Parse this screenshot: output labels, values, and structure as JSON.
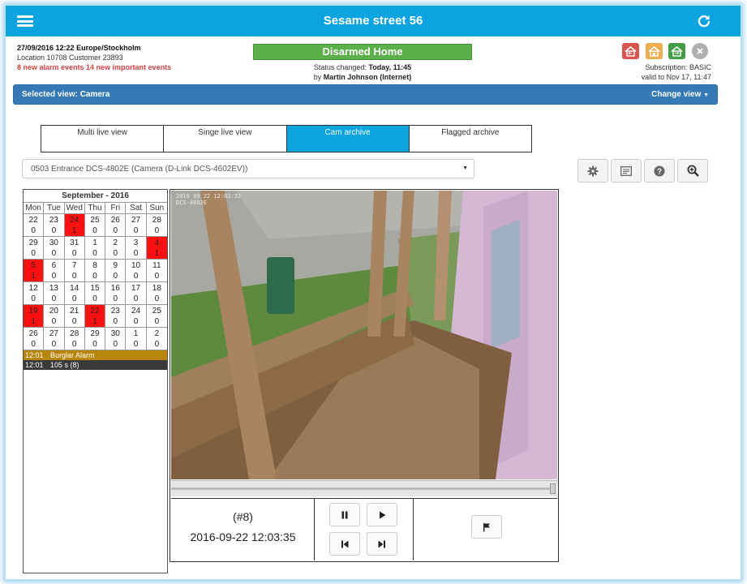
{
  "header": {
    "title": "Sesame street 56",
    "menu_icon": "hamburger-icon",
    "refresh_icon": "refresh-icon",
    "bar_color": "#0aa4e0"
  },
  "info": {
    "datetime": "27/09/2016 12:22 Europe/Stockholm",
    "location": "Location 10708 Customer 23893",
    "alerts": "8 new alarm events 14 new important events"
  },
  "status": {
    "label": "Disarmed Home",
    "changed_prefix": "Status changed: ",
    "changed_when": "Today, 11:45",
    "by_prefix": "by ",
    "by_who": "Martin Johnson (Internet)",
    "color": "#5bb04a"
  },
  "mode_icons": [
    {
      "name": "armed-away-icon",
      "color": "#d9534f"
    },
    {
      "name": "armed-home-icon",
      "color": "#f0ad4e"
    },
    {
      "name": "disarmed-home-icon",
      "color": "#449d44"
    },
    {
      "name": "disarmed-off-icon",
      "color": "#b0b0b0"
    }
  ],
  "subscription": {
    "line1": "Subscription: BASIC",
    "line2": "valid to Nov 17, 11:47"
  },
  "view_bar": {
    "selected": "Selected view: Camera",
    "change": "Change view"
  },
  "tabs": [
    {
      "label": "Multi live view",
      "active": false
    },
    {
      "label": "Singe live view",
      "active": false
    },
    {
      "label": "Cam archive",
      "active": true
    },
    {
      "label": "Flagged archive",
      "active": false
    }
  ],
  "camera_select": {
    "value": "0503 Entrance DCS-4802E (Camera (D-Link DCS-4602EV))"
  },
  "toolbar_icons": [
    "gear-icon",
    "list-icon",
    "help-icon",
    "zoom-in-icon"
  ],
  "calendar": {
    "title": "September - 2016",
    "weekdays": [
      "Mon",
      "Tue",
      "Wed",
      "Thu",
      "Fri",
      "Sat",
      "Sun"
    ],
    "weeks": [
      [
        {
          "d": "22",
          "c": "0"
        },
        {
          "d": "23",
          "c": "0"
        },
        {
          "d": "24",
          "c": "1",
          "alarm": true
        },
        {
          "d": "25",
          "c": "0"
        },
        {
          "d": "26",
          "c": "0"
        },
        {
          "d": "27",
          "c": "0"
        },
        {
          "d": "28",
          "c": "0"
        }
      ],
      [
        {
          "d": "29",
          "c": "0"
        },
        {
          "d": "30",
          "c": "0"
        },
        {
          "d": "31",
          "c": "0"
        },
        {
          "d": "1",
          "c": "0"
        },
        {
          "d": "2",
          "c": "0"
        },
        {
          "d": "3",
          "c": "0"
        },
        {
          "d": "4",
          "c": "1",
          "alarm": true
        }
      ],
      [
        {
          "d": "5",
          "c": "1",
          "alarm": true
        },
        {
          "d": "6",
          "c": "0"
        },
        {
          "d": "7",
          "c": "0"
        },
        {
          "d": "8",
          "c": "0"
        },
        {
          "d": "9",
          "c": "0"
        },
        {
          "d": "10",
          "c": "0"
        },
        {
          "d": "11",
          "c": "0"
        }
      ],
      [
        {
          "d": "12",
          "c": "0"
        },
        {
          "d": "13",
          "c": "0"
        },
        {
          "d": "14",
          "c": "0"
        },
        {
          "d": "15",
          "c": "0"
        },
        {
          "d": "16",
          "c": "0"
        },
        {
          "d": "17",
          "c": "0"
        },
        {
          "d": "18",
          "c": "0"
        }
      ],
      [
        {
          "d": "19",
          "c": "1",
          "alarm": true
        },
        {
          "d": "20",
          "c": "0"
        },
        {
          "d": "21",
          "c": "0"
        },
        {
          "d": "22",
          "c": "1",
          "alarm": true
        },
        {
          "d": "23",
          "c": "0"
        },
        {
          "d": "24",
          "c": "0"
        },
        {
          "d": "25",
          "c": "0"
        }
      ],
      [
        {
          "d": "26",
          "c": "0"
        },
        {
          "d": "27",
          "c": "0"
        },
        {
          "d": "28",
          "c": "0"
        },
        {
          "d": "29",
          "c": "0"
        },
        {
          "d": "30",
          "c": "0"
        },
        {
          "d": "1",
          "c": "0"
        },
        {
          "d": "2",
          "c": "0"
        }
      ]
    ],
    "events": [
      {
        "time": "12:01",
        "label": "Burglar Alarm",
        "kind": "alarm"
      },
      {
        "time": "12:01",
        "label": "105 s (8)",
        "kind": "clip"
      }
    ]
  },
  "video": {
    "osd_line1": "2016 09 22 12:03:32",
    "osd_line2": "DCS-4802E",
    "clip_number": "(#8)",
    "clip_time": "2016-09-22 12:03:35",
    "playback_icons": [
      "pause-icon",
      "play-icon",
      "skip-back-icon",
      "skip-forward-icon"
    ],
    "flag_icon": "flag-icon"
  }
}
